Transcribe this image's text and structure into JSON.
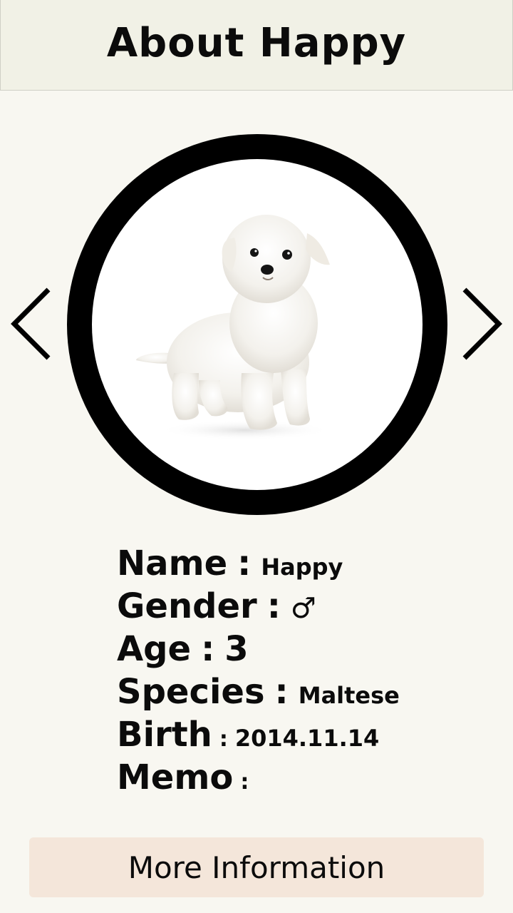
{
  "header": {
    "title": "About Happy"
  },
  "photo": {
    "icon": "dog-photo",
    "subject": "white maltese puppy"
  },
  "nav": {
    "prev_icon": "chevron-left-icon",
    "next_icon": "chevron-right-icon"
  },
  "info": {
    "name_label": "Name",
    "name_value": "Happy",
    "gender_label": "Gender",
    "gender_value": "♂",
    "age_label": "Age",
    "age_value": "3",
    "species_label": "Species",
    "species_value": "Maltese",
    "birth_label": "Birth",
    "birth_value": "2014.11.14",
    "memo_label": "Memo",
    "memo_value": "",
    "separator": ":"
  },
  "actions": {
    "more_label": "More Information"
  },
  "colors": {
    "background": "#f8f7f1",
    "header_bg": "#f1f1e6",
    "button_bg": "#f4e6da",
    "ring": "#000000"
  }
}
